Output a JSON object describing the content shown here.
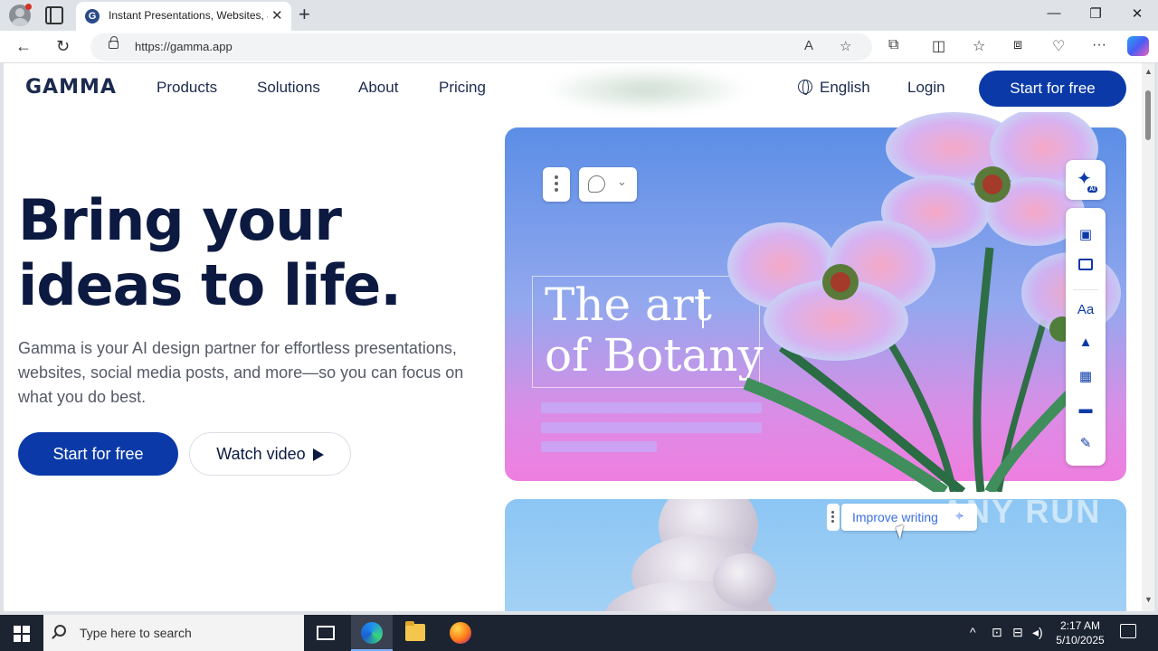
{
  "browser": {
    "tab_title": "Instant Presentations, Websites, &",
    "tab_favicon": "G",
    "url": "https://gamma.app",
    "icons": [
      "profile-icon",
      "tab-actions-icon",
      "close-icon",
      "new-tab-icon",
      "back-icon",
      "refresh-icon",
      "lock-icon",
      "read-aloud-icon",
      "favorite-star-icon",
      "extensions-icon",
      "split-screen-icon",
      "favorites-icon",
      "collections-icon",
      "performance-icon",
      "more-icon",
      "copilot-icon"
    ]
  },
  "header": {
    "logo": "GAMMA",
    "nav": [
      "Products",
      "Solutions",
      "About",
      "Pricing"
    ],
    "language": "English",
    "login": "Login",
    "cta": "Start for free"
  },
  "hero": {
    "title_line1": "Bring your",
    "title_line2": "ideas to life.",
    "subtitle": "Gamma is your AI design partner for effortless presentations, websites, social media posts, and more—so you can focus on what you do best.",
    "primary_cta": "Start for free",
    "secondary_cta": "Watch video"
  },
  "card1": {
    "title_line1": "The art",
    "title_line2": "of Botany",
    "ai_label": "AI",
    "tool_icons": [
      "card-add-icon",
      "layout-icon",
      "text-style-icon",
      "image-icon",
      "video-icon",
      "embed-icon",
      "edit-icon"
    ],
    "text_style_label": "Aa"
  },
  "card2": {
    "improve_label": "Improve writing",
    "watermark": "ANY RUN"
  },
  "taskbar": {
    "search_placeholder": "Type here to search",
    "time": "2:17 AM",
    "date": "5/10/2025"
  },
  "colors": {
    "brand_blue": "#0b3aa8",
    "text_dark": "#0c1a42"
  }
}
